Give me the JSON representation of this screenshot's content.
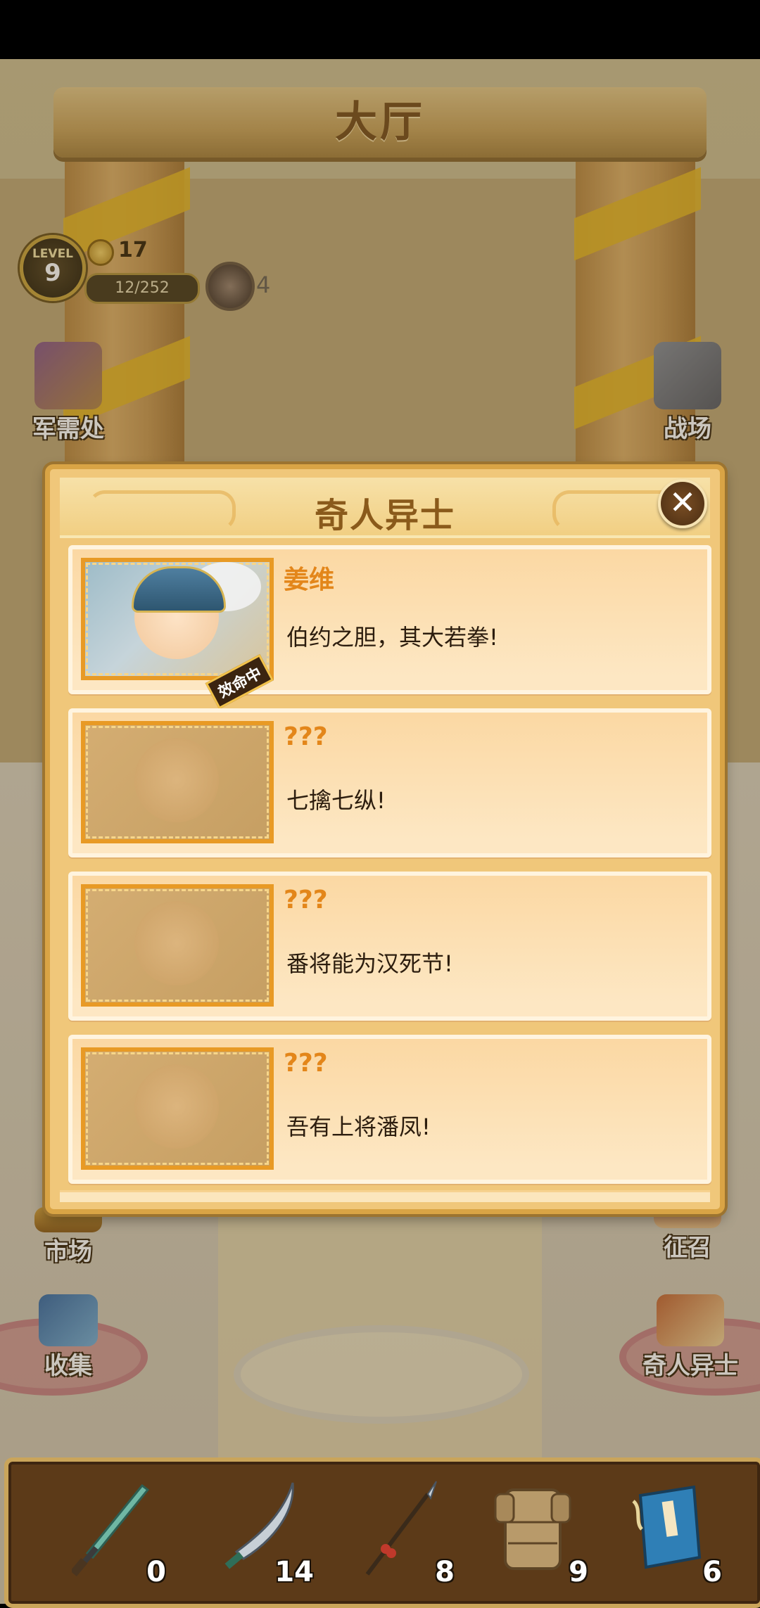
{
  "hall": {
    "title": "大厅"
  },
  "hud": {
    "level_label": "LEVEL",
    "level": "9",
    "gold": "17",
    "xp": "12/252",
    "demon_count": "4"
  },
  "side_buttons": {
    "supply": "军需处",
    "battlefield": "战场",
    "market": "市场",
    "recruit": "征召",
    "collect": "收集",
    "talents": "奇人异士"
  },
  "dialog": {
    "title": "奇人异士",
    "close": "✕",
    "cards": [
      {
        "name": "姜维",
        "quote": "伯约之胆，其大若拳!",
        "status": "效命中",
        "unlocked": true
      },
      {
        "name": "???",
        "quote": "七擒七纵!",
        "status": "",
        "unlocked": false
      },
      {
        "name": "???",
        "quote": "番将能为汉死节!",
        "status": "",
        "unlocked": false
      },
      {
        "name": "???",
        "quote": "吾有上将潘凤!",
        "status": "",
        "unlocked": false
      }
    ]
  },
  "inventory": [
    {
      "icon": "jade-sword-icon",
      "count": "0"
    },
    {
      "icon": "broadsword-icon",
      "count": "14"
    },
    {
      "icon": "spear-icon",
      "count": "8"
    },
    {
      "icon": "armor-icon",
      "count": "9"
    },
    {
      "icon": "book-icon",
      "count": "6"
    }
  ]
}
